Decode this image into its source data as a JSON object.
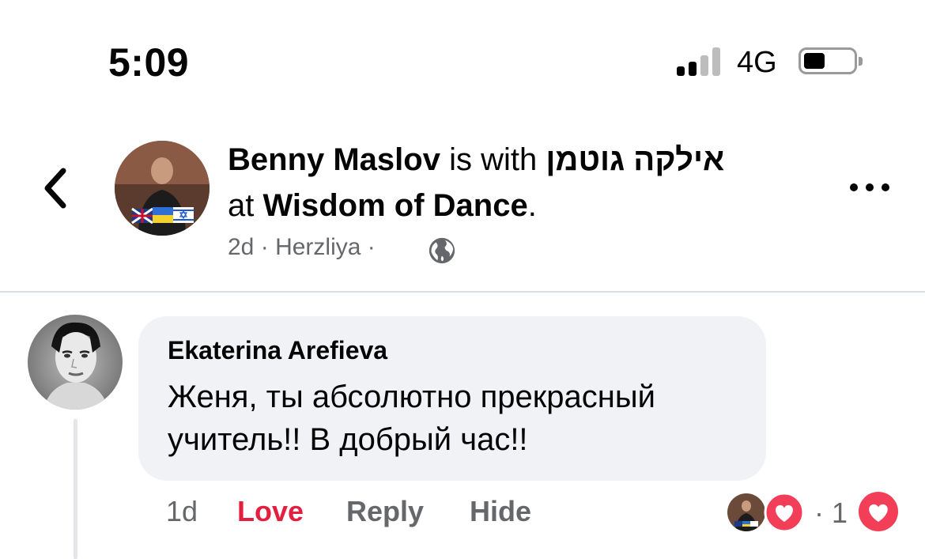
{
  "status_bar": {
    "time": "5:09",
    "network": "4G"
  },
  "post": {
    "author": "Benny Maslov",
    "with_text": " is with ",
    "tagged": "אילקה גוטמן",
    "at_text": "at ",
    "place": "Wisdom of Dance",
    "period": ".",
    "age": "2d",
    "sep": "·",
    "location": "Herzliya"
  },
  "comment": {
    "author": "Ekaterina Arefieva",
    "text": "Женя, ты абсолютно прекрасный учитель!! В добрый час!!",
    "age": "1d",
    "love_label": "Love",
    "reply_label": "Reply",
    "hide_label": "Hide",
    "reaction_sep": "·",
    "reaction_count": "1"
  },
  "colors": {
    "love": "#e41e3f",
    "secondary_text": "#65676b",
    "bubble": "#f0f2f5"
  },
  "icons": [
    "back-chevron-icon",
    "globe-icon",
    "more-dots-icon",
    "heart-reaction-icon"
  ]
}
